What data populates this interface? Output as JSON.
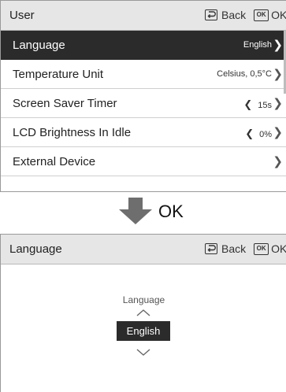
{
  "top_screen": {
    "header": {
      "title": "User",
      "back_label": "Back",
      "ok_icon": "OK",
      "ok_label": "OK"
    },
    "menu": [
      {
        "label": "Language",
        "value": "English",
        "selected": true
      },
      {
        "label": "Temperature Unit",
        "value": "Celsius, 0,5°C"
      },
      {
        "label": "Screen Saver Timer",
        "value": "15s"
      },
      {
        "label": "LCD Brightness In Idle",
        "value": "0%"
      },
      {
        "label": "External Device",
        "value": ""
      }
    ]
  },
  "transition": {
    "label": "OK"
  },
  "bottom_screen": {
    "header": {
      "title": "Language",
      "back_label": "Back",
      "ok_icon": "OK",
      "ok_label": "OK"
    },
    "picker": {
      "title": "Language",
      "current": "English"
    }
  },
  "colors": {
    "header_bg": "#e6e6e6",
    "selected_bg": "#2b2b2b",
    "arrow": "#6e6e6e"
  },
  "icons": [
    "back-icon",
    "ok-icon",
    "chevron-right-icon",
    "chevron-left-icon",
    "chevron-up-icon",
    "chevron-down-icon",
    "down-arrow-icon"
  ]
}
